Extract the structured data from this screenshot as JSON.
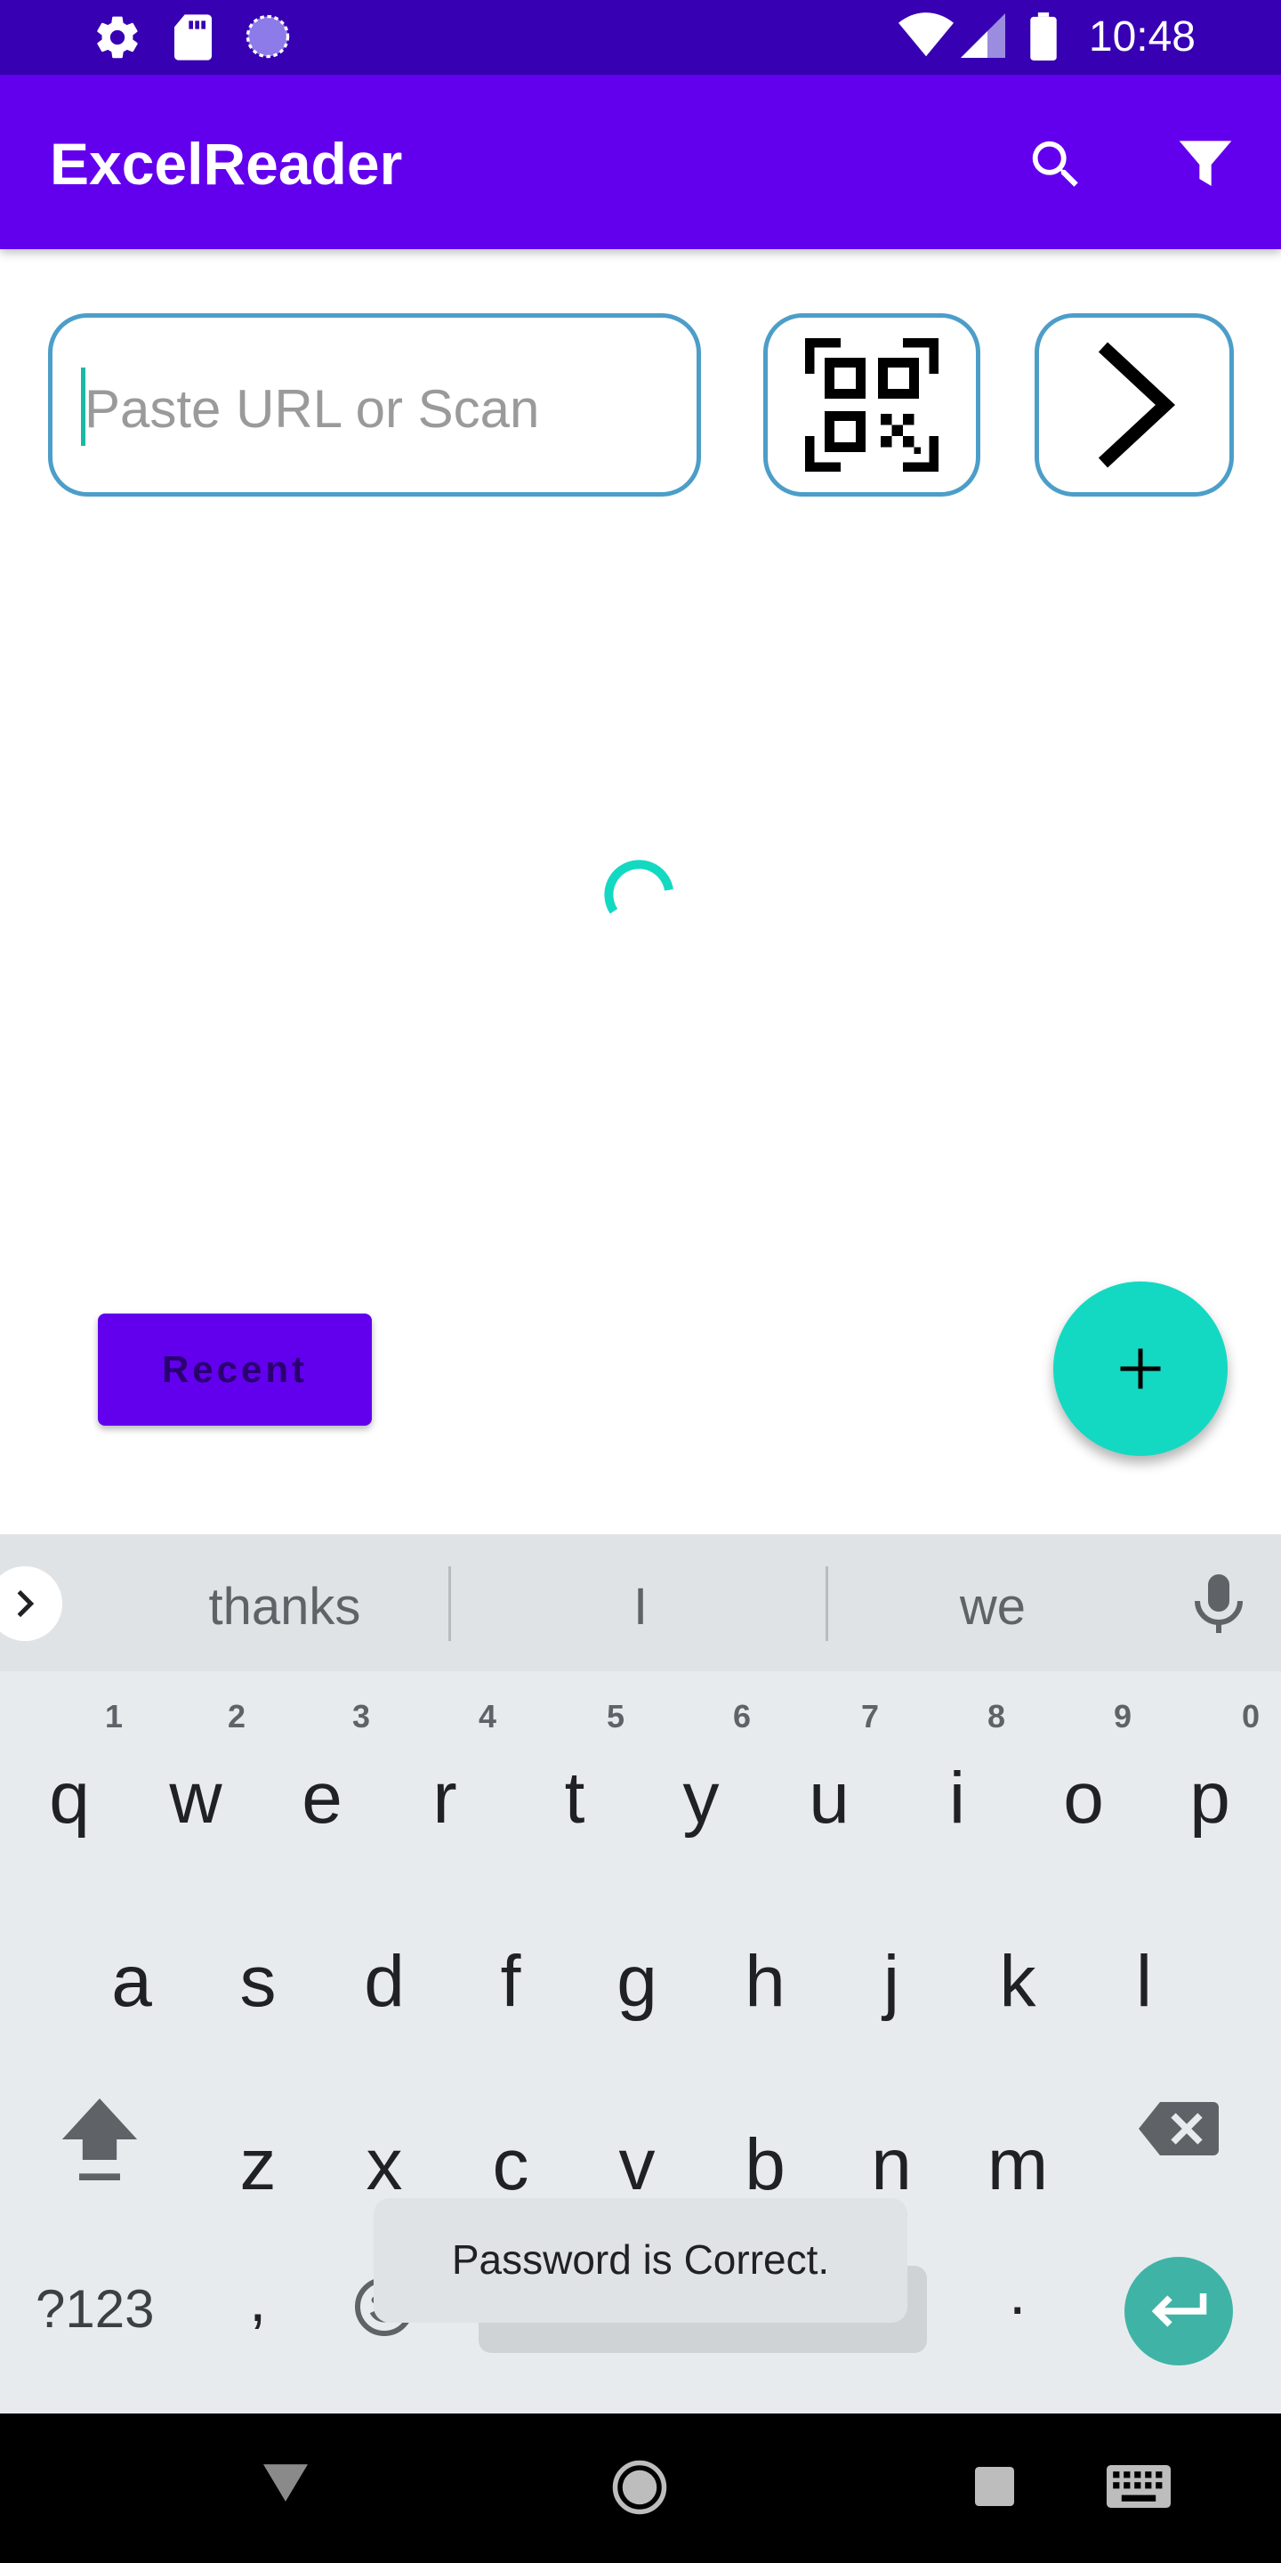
{
  "status_bar": {
    "time": "10:48",
    "icons": [
      "settings-icon",
      "sd-card-icon",
      "sync-icon",
      "wifi-icon",
      "signal-icon",
      "battery-icon"
    ]
  },
  "app_bar": {
    "title": "ExcelReader",
    "actions": [
      "search-icon",
      "filter-icon"
    ],
    "color": "#6200ee"
  },
  "url_input": {
    "value": "",
    "placeholder": "Paste URL or Scan"
  },
  "buttons": {
    "scan": "qr-code-icon",
    "go": "chevron-right-icon",
    "recent_label": "Recent",
    "fab": "plus-icon"
  },
  "loading": {
    "spinner_color": "#14d9c2"
  },
  "keyboard": {
    "suggestions": [
      "thanks",
      "I",
      "we"
    ],
    "row1": [
      "q",
      "w",
      "e",
      "r",
      "t",
      "y",
      "u",
      "i",
      "o",
      "p"
    ],
    "row1_hints": [
      "1",
      "2",
      "3",
      "4",
      "5",
      "6",
      "7",
      "8",
      "9",
      "0"
    ],
    "row2": [
      "a",
      "s",
      "d",
      "f",
      "g",
      "h",
      "j",
      "k",
      "l"
    ],
    "row3": [
      "z",
      "x",
      "c",
      "v",
      "b",
      "n",
      "m"
    ],
    "symbols_key": "?123",
    "comma": ",",
    "period": "."
  },
  "toast": {
    "message": "Password is Correct."
  },
  "nav_bar": {
    "icons": [
      "back-icon",
      "home-icon",
      "recents-icon",
      "keyboard-icon"
    ]
  }
}
